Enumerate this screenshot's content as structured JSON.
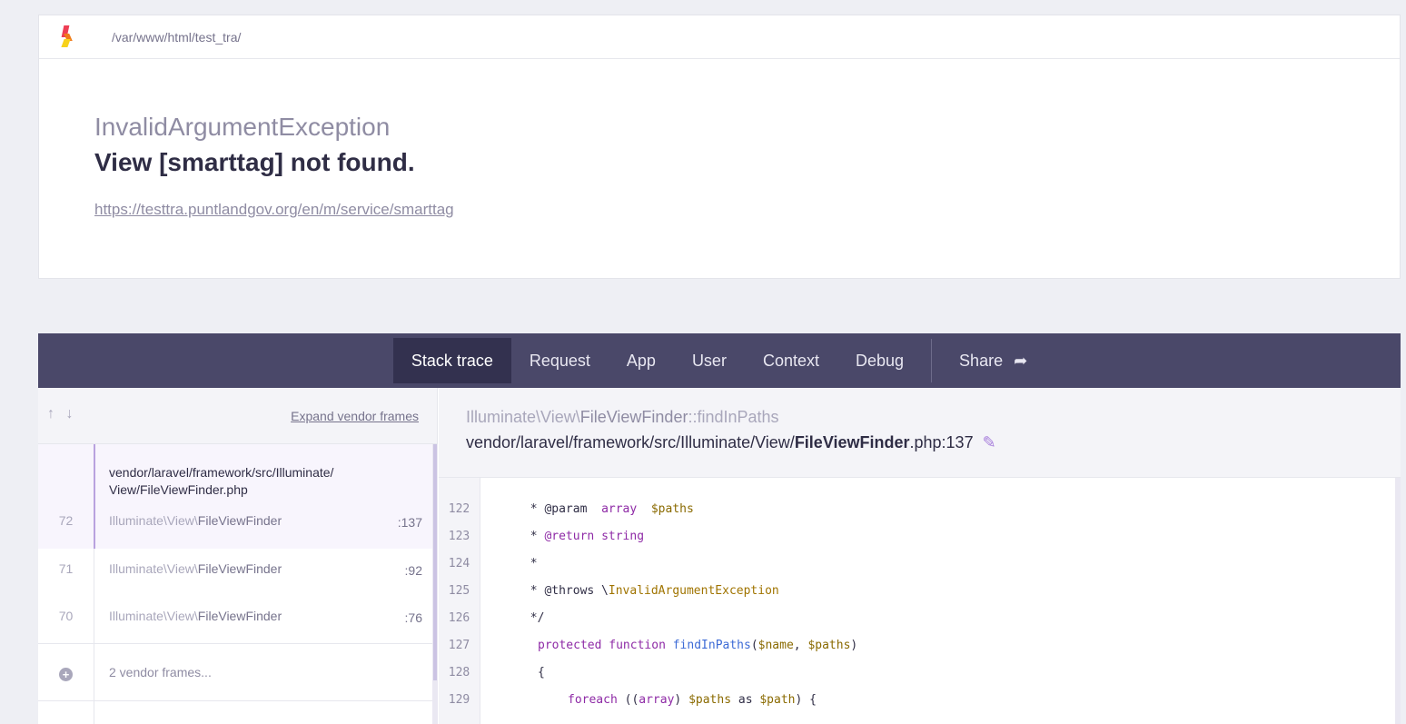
{
  "header": {
    "path": "/var/www/html/test_tra/"
  },
  "error": {
    "exception_class": "InvalidArgumentException",
    "message": "View [smarttag] not found.",
    "url": "https://testtra.puntlandgov.org/en/m/service/smarttag"
  },
  "tabs": [
    {
      "label": "Stack trace"
    },
    {
      "label": "Request"
    },
    {
      "label": "App"
    },
    {
      "label": "User"
    },
    {
      "label": "Context"
    },
    {
      "label": "Debug"
    },
    {
      "label": "Share"
    }
  ],
  "left": {
    "arrows": "↑ ↓",
    "expand_label": "Expand vendor frames",
    "frames": [
      {
        "number": "72",
        "file_prefix": "vendor/laravel/framework/src/Illuminate/ View/",
        "file_name": "FileViewFinder",
        "file_ext": ".php",
        "class_prefix": "Illuminate\\View\\",
        "class_name": "FileViewFinder",
        "line": ":137"
      },
      {
        "number": "71",
        "class_prefix": "Illuminate\\View\\",
        "class_name": "FileViewFinder",
        "line": ":92"
      },
      {
        "number": "70",
        "class_prefix": "Illuminate\\View\\",
        "class_name": "FileViewFinder",
        "line": ":76"
      }
    ],
    "vendor_label": "2 vendor frames..."
  },
  "right": {
    "fn_prefix": "Illuminate\\View\\",
    "fn_class": "FileViewFinder",
    "fn_method": "::findInPaths",
    "file_prefix": "vendor/laravel/framework/src/Illuminate/View/",
    "file_name": "FileViewFinder",
    "file_ext": ".php:137",
    "code_lines": [
      {
        "n": "122"
      },
      {
        "n": "123"
      },
      {
        "n": "124"
      },
      {
        "n": "125"
      },
      {
        "n": "126"
      },
      {
        "n": "127"
      },
      {
        "n": "128"
      },
      {
        "n": "129"
      }
    ],
    "code": {
      "l122_a": "       * @param  ",
      "l122_b": "array",
      "l122_c": "  ",
      "l122_d": "$paths",
      "l123_a": "       * ",
      "l123_b": "@return",
      "l123_c": " ",
      "l123_d": "string",
      "l124": "       *",
      "l125_a": "       * @throws \\",
      "l125_b": "InvalidArgumentException",
      "l126": "       */",
      "l127_a": "protected",
      "l127_b": " ",
      "l127_c": "function",
      "l127_d": " ",
      "l127_e": "findInPaths",
      "l127_f": "(",
      "l127_g": "$name",
      "l127_h": ", ",
      "l127_i": "$paths",
      "l127_j": ")",
      "l128": "{",
      "l129_a": "foreach",
      "l129_b": " ((",
      "l129_c": "array",
      "l129_d": ") ",
      "l129_e": "$paths",
      "l129_f": " as ",
      "l129_g": "$path",
      "l129_h": ") {"
    }
  }
}
